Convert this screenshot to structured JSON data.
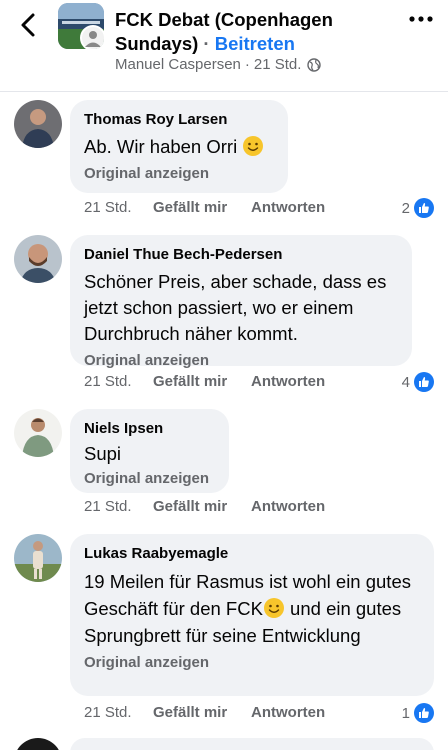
{
  "header": {
    "group_name": "FCK Debat (Copenhagen Sundays)",
    "dot": " · ",
    "join_label": "Beitreten",
    "author": "Manuel Caspersen",
    "separator": " · ",
    "time": "21 Std."
  },
  "comments": [
    {
      "author": "Thomas Roy Larsen",
      "text": "Ab. Wir haben Orri",
      "has_emoji": true,
      "original_label": "Original anzeigen",
      "time": "21 Std.",
      "like_label": "Gefällt mir",
      "reply_label": "Antworten",
      "reactions": "2"
    },
    {
      "author": "Daniel Thue Bech-Pedersen",
      "text": "Schöner Preis, aber schade, dass es jetzt schon passiert, wo er einem Durchbruch näher kommt.",
      "original_label": "Original anzeigen",
      "time": "21 Std.",
      "like_label": "Gefällt mir",
      "reply_label": "Antworten",
      "reactions": "4"
    },
    {
      "author": "Niels Ipsen",
      "text": "Supi",
      "original_label": "Original anzeigen",
      "time": "21 Std.",
      "like_label": "Gefällt mir",
      "reply_label": "Antworten"
    },
    {
      "author": "Lukas Raabyemagle",
      "text_part1": "19 Meilen für Rasmus ist wohl ein gutes Geschäft für den FCK",
      "text_part2": " und ein gutes Sprungbrett für seine Entwicklung",
      "original_label": "Original anzeigen",
      "time": "21 Std.",
      "like_label": "Gefällt mir",
      "reply_label": "Antworten",
      "reactions": "1"
    }
  ],
  "colors": {
    "link": "#1877f2",
    "secondary_text": "#65676b",
    "bubble": "#f0f2f5"
  }
}
